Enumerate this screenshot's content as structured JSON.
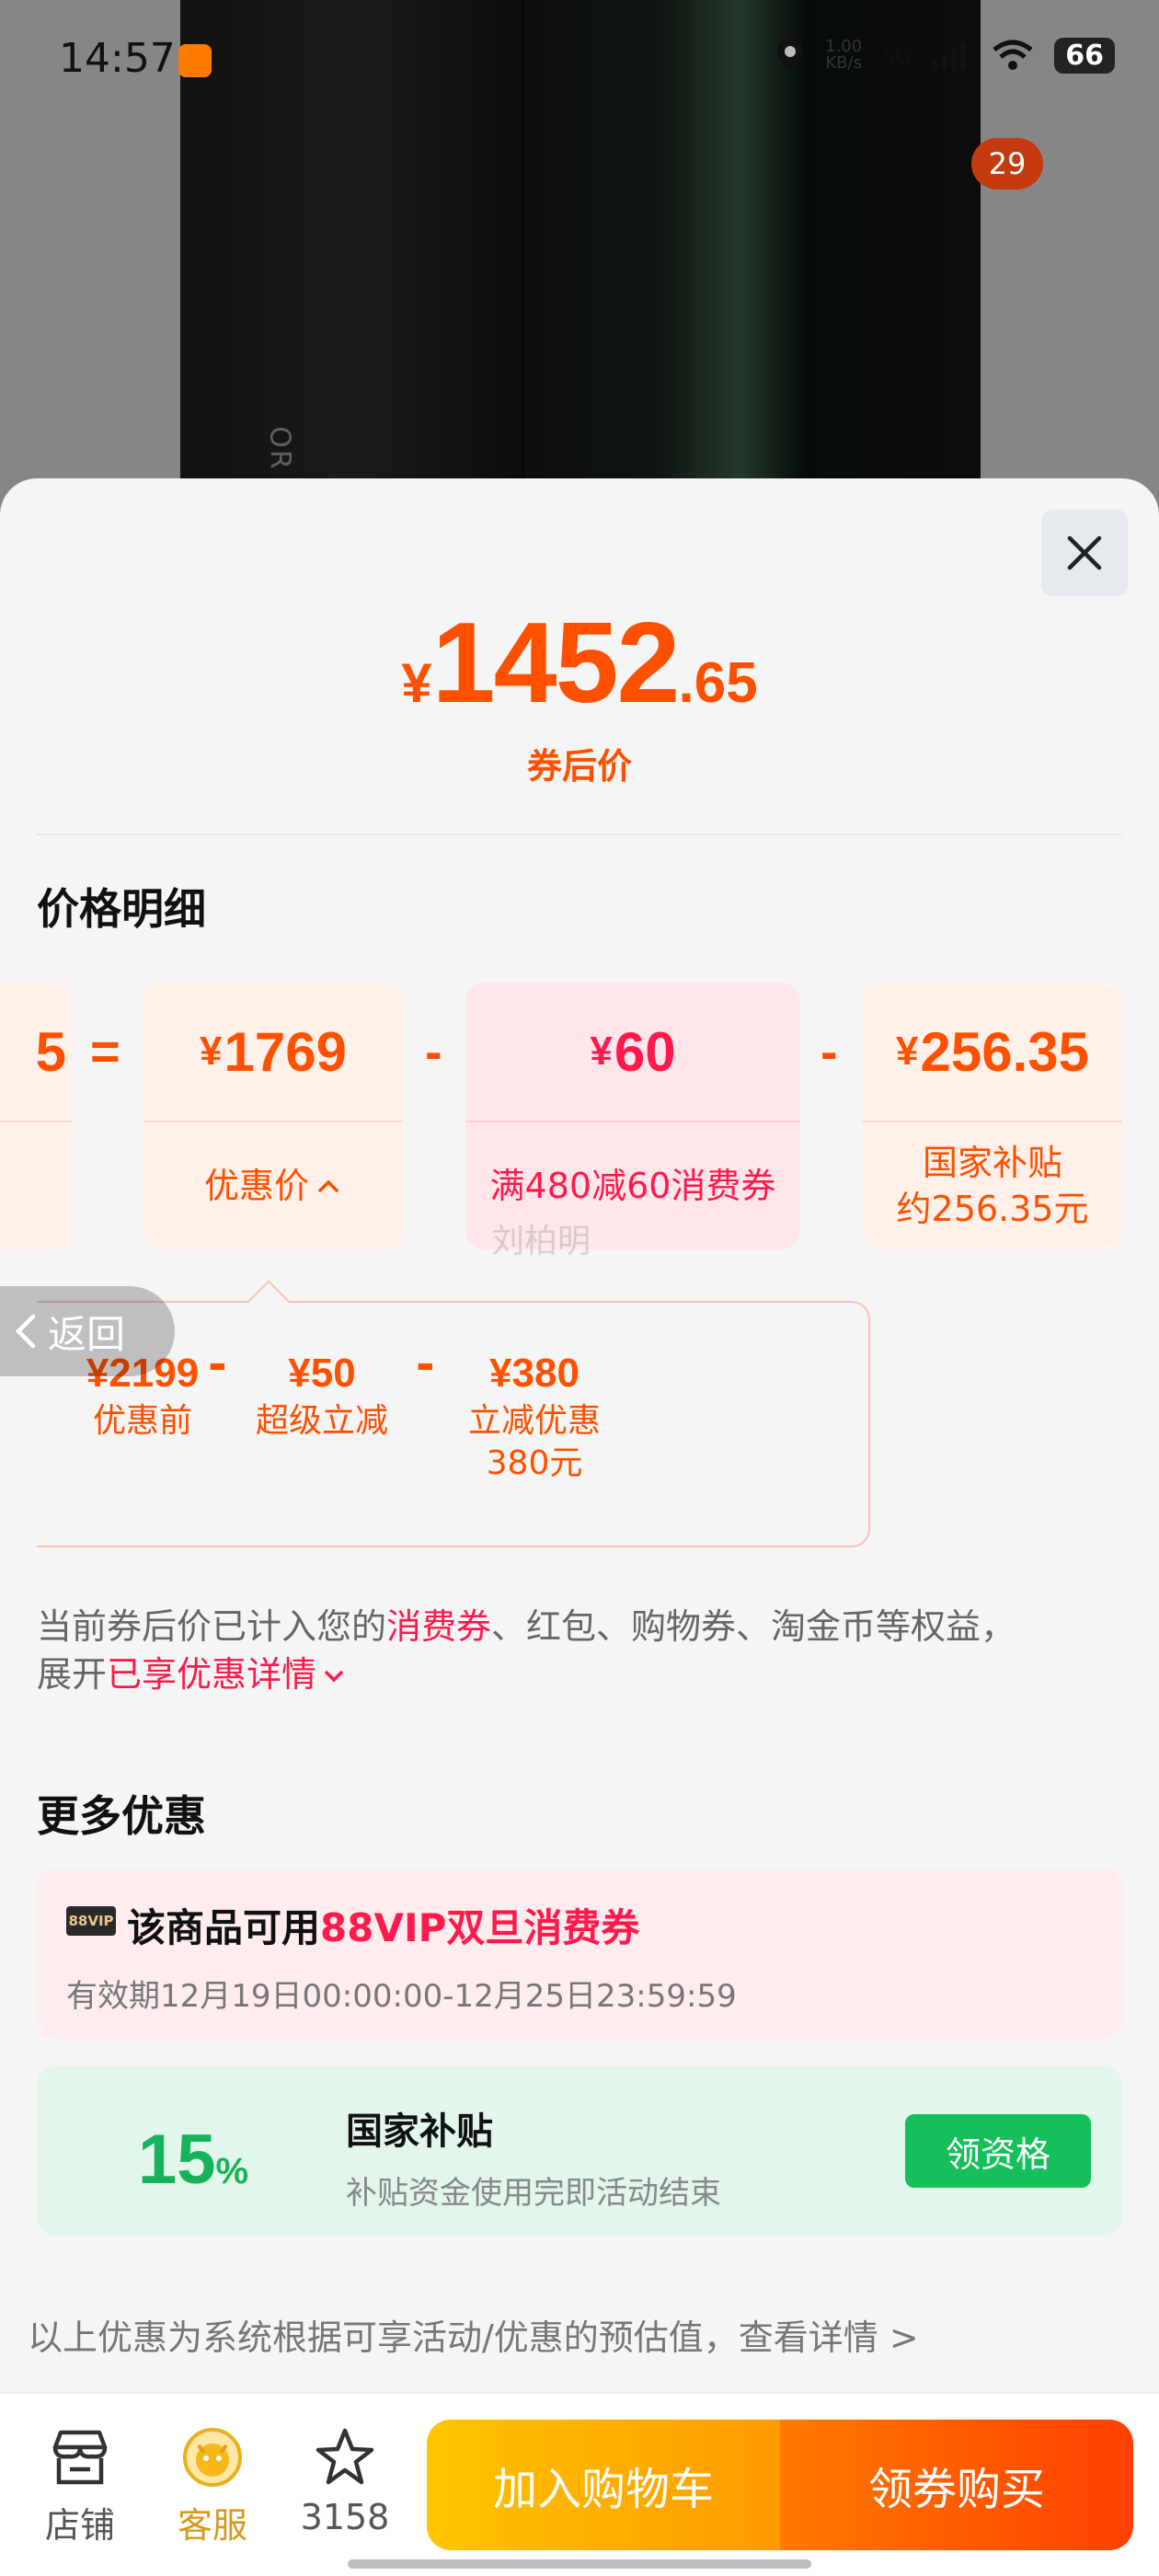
{
  "status_bar": {
    "time": "14:57",
    "net_speed": "1.00\nKB/s",
    "network": "5G",
    "battery": "66"
  },
  "background": {
    "brand_text": "OR",
    "badge_count": "29"
  },
  "sheet": {
    "price": {
      "yen": "¥",
      "integer": "1452",
      "decimal": ".65",
      "caption": "券后价"
    },
    "detail_title": "价格明细",
    "cards": [
      {
        "value": "5",
        "label": ""
      },
      {
        "yen": "¥",
        "value": "1769",
        "label": "优惠价"
      },
      {
        "yen": "¥",
        "value": "60",
        "label": "满480减60消费券"
      },
      {
        "yen": "¥",
        "value": "256.35",
        "label_line1": "国家补贴",
        "label_line2": "约256.35元"
      }
    ],
    "operators": [
      "=",
      "-",
      "-"
    ],
    "breakdown": [
      {
        "value": "¥2199",
        "label": "优惠前"
      },
      {
        "value": "¥50",
        "label": "超级立减"
      },
      {
        "value": "¥380",
        "label_line1": "立减优惠",
        "label_line2": "380元"
      }
    ],
    "breakdown_ops": [
      "-",
      "-"
    ],
    "watermark": "刘柏明",
    "note": {
      "part1": "当前券后价已计入您的",
      "highlight1": "消费券",
      "part2": "、红包、购物券、淘金币等权益，",
      "part3": "展开",
      "highlight2": "已享优惠详情"
    },
    "back_label": "返回",
    "more_title": "更多优惠",
    "vip": {
      "badge": "88VIP",
      "title_prefix": "该商品可用",
      "title_highlight": "88VIP双旦消费券",
      "validity": "有效期12月19日00:00:00-12月25日23:59:59"
    },
    "subsidy": {
      "percent": "15",
      "percent_sign": "%",
      "title": "国家补贴",
      "subtitle": "补贴资金使用完即活动结束",
      "button": "领资格"
    },
    "footnote": "以上优惠为系统根据可享活动/优惠的预估值，查看详情 >"
  },
  "bottom_bar": {
    "shop": "店铺",
    "service": "客服",
    "favorites_count": "3158",
    "add_to_cart": "加入购物车",
    "buy_with_coupon": "领券购买"
  },
  "colors": {
    "accent_orange": "#ff5000",
    "accent_pink": "#ff1a4b",
    "subsidy_green": "#17b35a"
  }
}
